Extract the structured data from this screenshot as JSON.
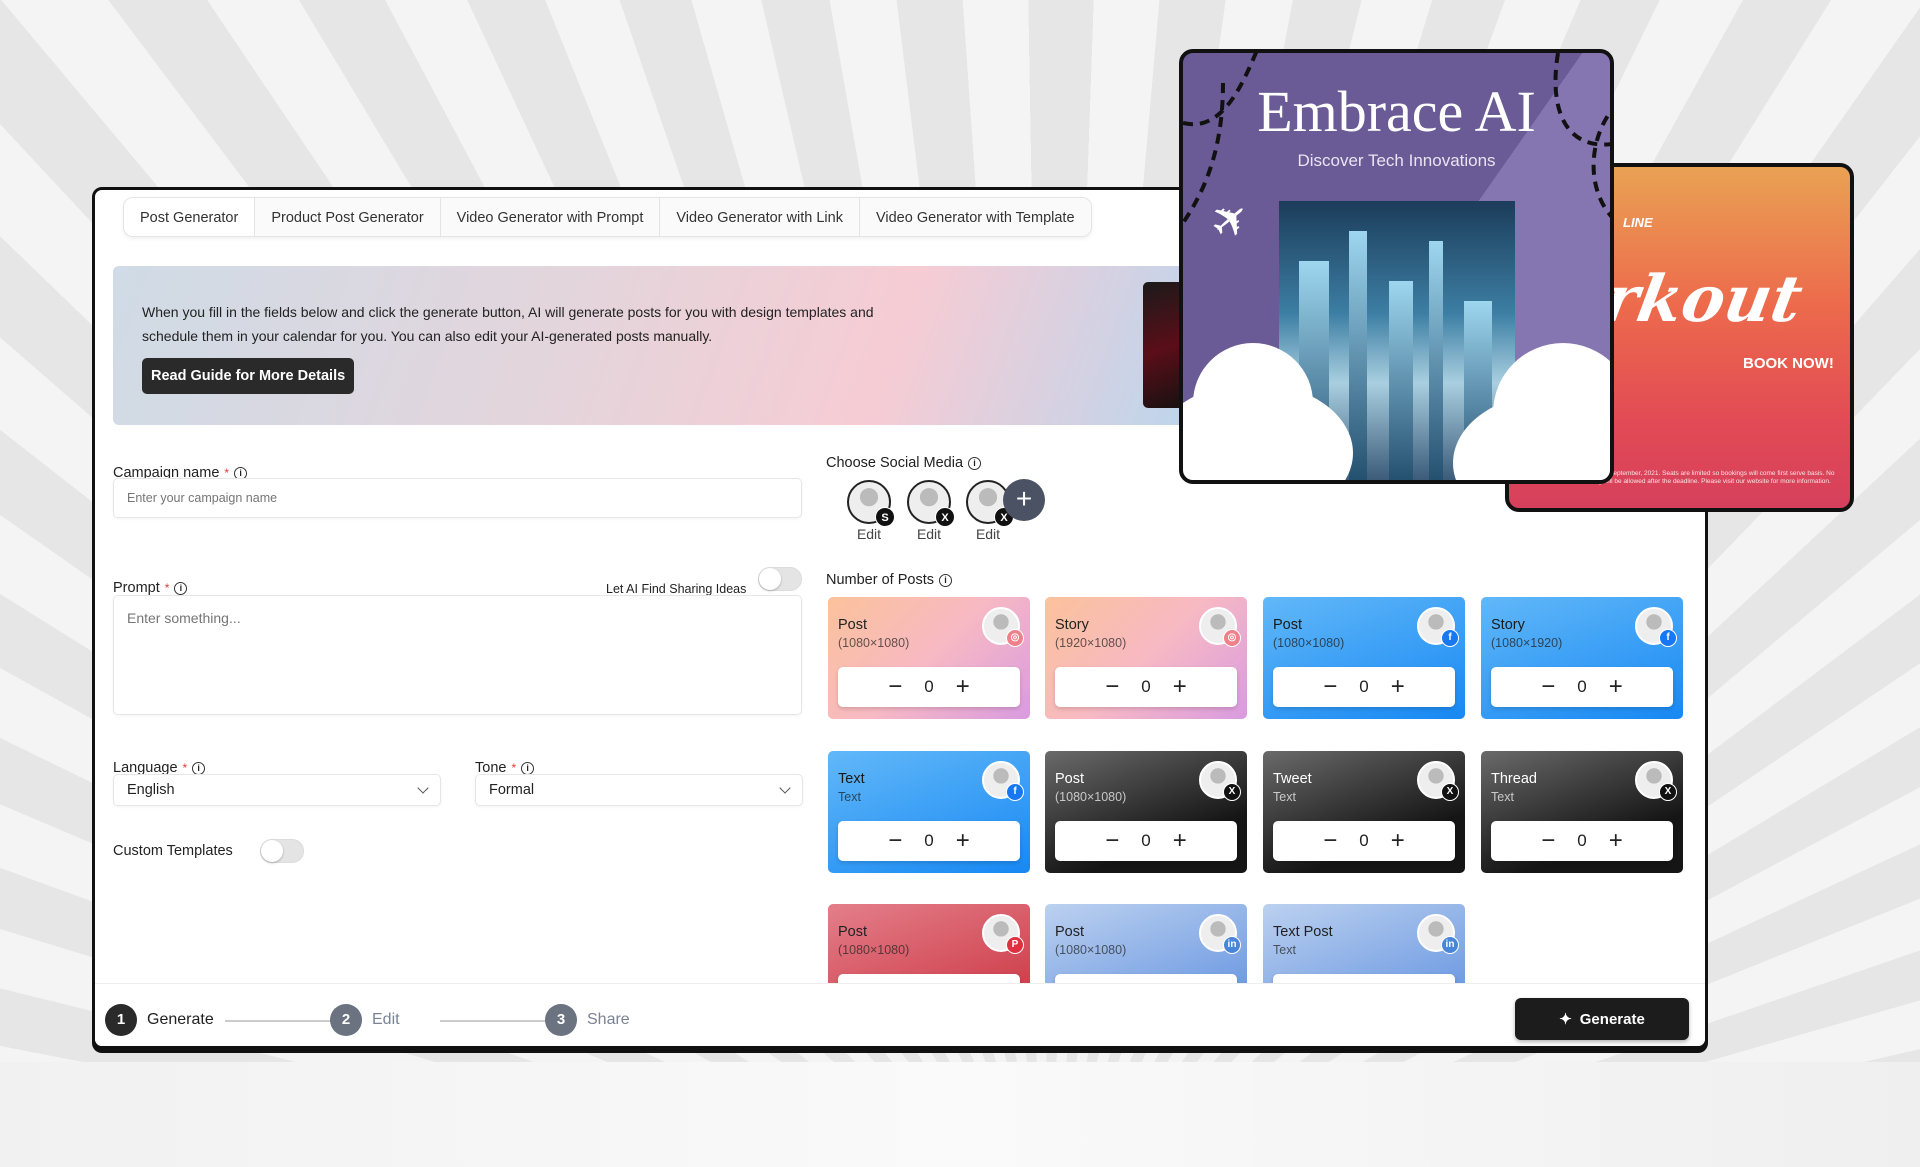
{
  "tabs": [
    "Post Generator",
    "Product Post Generator",
    "Video Generator with Prompt",
    "Video Generator with Link",
    "Video Generator with Template"
  ],
  "active_tab": 0,
  "banner": {
    "text": "When you fill in the fields below and click the generate button, AI will generate posts for you with design templates and schedule them in your calendar for you. You can also edit your AI-generated posts manually.",
    "button": "Read Guide for More Details"
  },
  "form": {
    "campaign_label": "Campaign name",
    "campaign_placeholder": "Enter your campaign name",
    "campaign_value": "",
    "prompt_label": "Prompt",
    "prompt_placeholder": "Enter something...",
    "prompt_value": "",
    "ai_ideas_label": "Let AI Find Sharing Ideas",
    "ai_ideas_on": false,
    "language_label": "Language",
    "language_value": "English",
    "tone_label": "Tone",
    "tone_value": "Formal",
    "custom_templates_label": "Custom Templates",
    "custom_templates_on": false,
    "required_mark": "*"
  },
  "social": {
    "label": "Choose Social Media",
    "accounts": [
      {
        "badge": "S",
        "edit": "Edit"
      },
      {
        "badge": "X",
        "edit": "Edit"
      },
      {
        "badge": "X",
        "edit": "Edit"
      }
    ],
    "add": "+"
  },
  "posts": {
    "label": "Number of Posts",
    "cards": [
      {
        "title": "Post",
        "sub": "(1080×1080)",
        "network": "instagram",
        "count": 0
      },
      {
        "title": "Story",
        "sub": "(1920×1080)",
        "network": "instagram",
        "count": 0
      },
      {
        "title": "Post",
        "sub": "(1080×1080)",
        "network": "facebook",
        "count": 0
      },
      {
        "title": "Story",
        "sub": "(1080×1920)",
        "network": "facebook",
        "count": 0
      },
      {
        "title": "Text",
        "sub": "Text",
        "network": "facebook",
        "count": 0
      },
      {
        "title": "Post",
        "sub": "(1080×1080)",
        "network": "x",
        "count": 0
      },
      {
        "title": "Tweet",
        "sub": "Text",
        "network": "x",
        "count": 0
      },
      {
        "title": "Thread",
        "sub": "Text",
        "network": "x",
        "count": 0
      },
      {
        "title": "Post",
        "sub": "(1080×1080)",
        "network": "pinterest"
      },
      {
        "title": "Post",
        "sub": "(1080×1080)",
        "network": "linkedin"
      },
      {
        "title": "Text Post",
        "sub": "Text",
        "network": "linkedin"
      }
    ],
    "minus": "−",
    "plus": "+"
  },
  "network_styles": {
    "instagram": {
      "bg": "linear-gradient(135deg,#fcc29b 0%,#f7b9c3 50%,#d99be0 100%)",
      "fg": "#222",
      "badge": "#f0808a",
      "glyph": "◎"
    },
    "facebook": {
      "bg": "linear-gradient(160deg,#62b8f8 0%,#1788f3 100%)",
      "fg": "#1a1a1a",
      "badge": "#1877f2",
      "glyph": "f"
    },
    "x": {
      "bg": "linear-gradient(160deg,#6a6a6a 0%,#151515 70%)",
      "fg": "#fff",
      "badge": "#111",
      "glyph": "X"
    },
    "pinterest": {
      "bg": "linear-gradient(160deg,#e37f8a 0%,#c92f3c 100%)",
      "fg": "#222",
      "badge": "#e03040",
      "glyph": "P"
    },
    "linkedin": {
      "bg": "linear-gradient(160deg,#bcd1ef 0%,#5b8ddf 100%)",
      "fg": "#222",
      "badge": "#4a86d8",
      "glyph": "in"
    }
  },
  "footer": {
    "steps": [
      {
        "n": "1",
        "label": "Generate",
        "active": true
      },
      {
        "n": "2",
        "label": "Edit",
        "active": false
      },
      {
        "n": "3",
        "label": "Share",
        "active": false
      }
    ],
    "generate": "Generate"
  },
  "promos": {
    "embrace": {
      "title": "Embrace AI",
      "subtitle": "Discover Tech Innovations"
    },
    "workout": {
      "line": "LINE",
      "title": "Workout",
      "cta": "BOOK NOW!",
      "fine": "ng is 20th September, 2021. Seats are limited so bookings will come first serve basis. No booking will be allowed after the deadline. Please visit our website for more information."
    }
  },
  "colors": {
    "accent": "#1c1c1c",
    "required": "#e53935",
    "step_inactive": "#6b7280"
  }
}
